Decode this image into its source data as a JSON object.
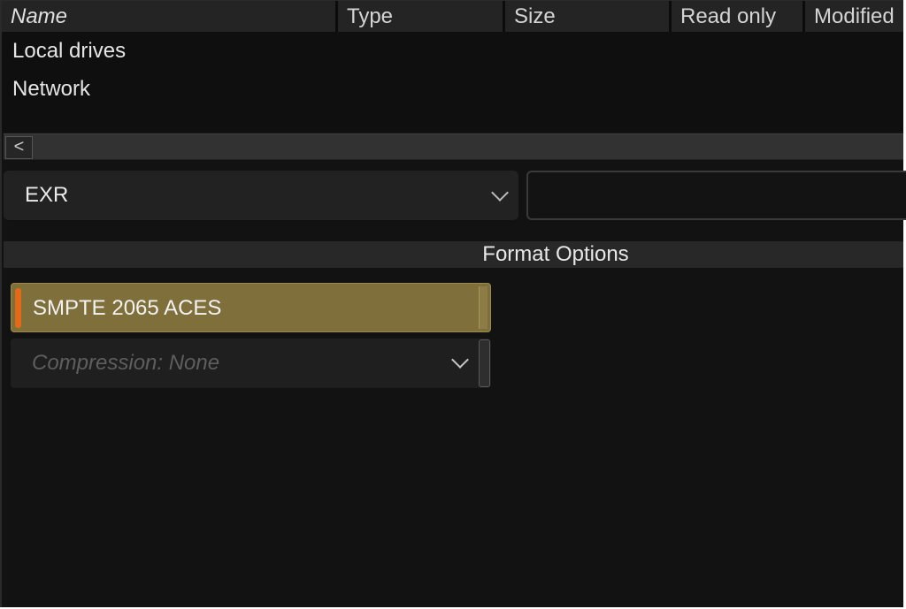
{
  "columns": {
    "name": "Name",
    "type": "Type",
    "size": "Size",
    "read_only": "Read only",
    "modified": "Modified"
  },
  "locations": [
    {
      "label": "Local drives"
    },
    {
      "label": "Network"
    }
  ],
  "scrollbar": {
    "left_glyph": "<"
  },
  "format": {
    "selected": "EXR"
  },
  "filter": {
    "value": ""
  },
  "format_options": {
    "title": "Format Options",
    "color_space_label": "SMPTE 2065 ACES",
    "compression_label": "Compression: None"
  },
  "colors": {
    "background": "#121212",
    "header": "#242424",
    "aces_button": "#7f6f3a",
    "active_marker": "#e26a17"
  },
  "icons": {
    "scroll_left": "chevron-left-icon",
    "dropdown": "chevron-down-icon"
  }
}
